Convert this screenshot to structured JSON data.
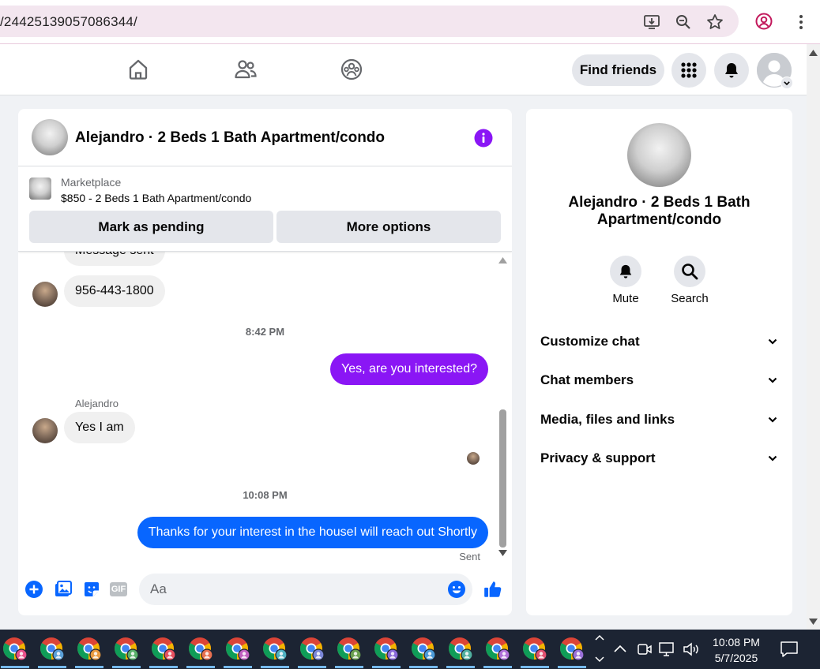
{
  "browser": {
    "url": "/24425139057086344/"
  },
  "nav": {
    "find_friends": "Find friends"
  },
  "chat": {
    "title": "Alejandro · 2 Beds 1 Bath Apartment/condo",
    "listing": {
      "label": "Marketplace",
      "price_title": "$850 - 2 Beds 1 Bath Apartment/condo",
      "mark_pending": "Mark as pending",
      "more_options": "More options"
    },
    "messages": [
      {
        "type": "in",
        "text": "Message sent"
      },
      {
        "type": "in",
        "text": "956-443-1800"
      },
      {
        "type": "time",
        "text": "8:42 PM"
      },
      {
        "type": "out",
        "text": "Yes, are you interested?"
      },
      {
        "type": "sender",
        "text": "Alejandro"
      },
      {
        "type": "in",
        "text": "Yes I am"
      },
      {
        "type": "time",
        "text": "10:08 PM"
      },
      {
        "type": "out",
        "text": "Thanks for your interest in the houseI will reach out Shortly"
      },
      {
        "type": "status",
        "text": "Sent"
      }
    ],
    "composer": {
      "placeholder": "Aa",
      "gif": "GIF"
    }
  },
  "info_panel": {
    "name": "Alejandro · 2 Beds 1 Bath Apartment/condo",
    "mute": "Mute",
    "search": "Search",
    "sections": [
      "Customize chat",
      "Chat members",
      "Media, files and links",
      "Privacy & support"
    ]
  },
  "taskbar": {
    "time": "10:08 PM",
    "date": "5/7/2025"
  },
  "colors": {
    "messenger_purple": "#8a16f5",
    "messenger_blue": "#0866ff",
    "taskbar": "#1c2433"
  }
}
